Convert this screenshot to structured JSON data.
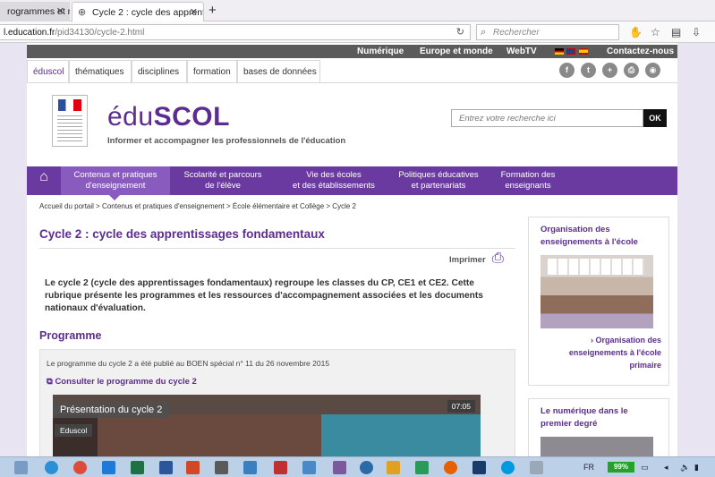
{
  "browser": {
    "tabs": [
      {
        "label": "rogrammes et r...",
        "active": false
      },
      {
        "label": "Cycle 2 : cycle des apprenti...",
        "active": true
      }
    ],
    "new_tab_symbol": "+",
    "close_symbol": "✕",
    "url_host": "l.education.fr",
    "url_path": "/pid34130/cycle-2.html",
    "search_placeholder": "Rechercher",
    "icons": [
      "reload-icon",
      "search-icon",
      "addon-icon",
      "bookmark-star-icon",
      "reading-list-icon",
      "download-icon"
    ]
  },
  "site": {
    "top_links": [
      "Numérique",
      "Europe et monde",
      "WebTV",
      "Contactez-nous"
    ],
    "menu_tabs": [
      "éduscol",
      "thématiques",
      "disciplines",
      "formation",
      "bases de données"
    ],
    "social_icons": [
      "facebook-icon",
      "twitter-icon",
      "google-plus-icon",
      "print-icon",
      "rss-icon"
    ],
    "logo": {
      "word_light": "édu",
      "word_bold": "SCOL",
      "tagline": "Informer et accompagner les professionnels de l'éducation"
    },
    "search": {
      "placeholder": "Entrez votre recherche ici",
      "button": "OK"
    },
    "main_nav": [
      {
        "label": "Contenus et pratiques\nd'enseignement",
        "current": true
      },
      {
        "label": "Scolarité et parcours\nde l'élève",
        "current": false
      },
      {
        "label": "Vie des écoles\net des établissements",
        "current": false
      },
      {
        "label": "Politiques éducatives\net partenariats",
        "current": false
      },
      {
        "label": "Formation des\nenseignants",
        "current": false
      }
    ],
    "breadcrumb": "Accueil du portail > Contenus et pratiques d'enseignement > École élémentaire et Collège > Cycle 2",
    "page_title": "Cycle 2 : cycle des apprentissages fondamentaux",
    "print_label": "Imprimer",
    "intro": "Le cycle 2 (cycle des apprentissages fondamentaux) regroupe les classes du CP, CE1 et CE2. Cette rubrique présente les programmes et les ressources d'accompagnement associées et les documents nationaux d'évaluation.",
    "section_heading": "Programme",
    "programme_note": "Le programme du cycle 2 a été publié au BOEN spécial n° 11 du 26 novembre 2015",
    "programme_link": "Consulter le programme du cycle 2",
    "video": {
      "title": "Présentation du cycle 2",
      "duration": "07:05",
      "source": "Eduscol"
    },
    "sidebar": [
      {
        "title": "Organisation des enseignements à l'école",
        "link": "Organisation des enseignements à l'école primaire"
      },
      {
        "title": "Le numérique dans le premier degré"
      }
    ]
  },
  "taskbar": {
    "language": "FR",
    "battery": "99%"
  },
  "colors": {
    "brand_purple": "#5c2d91",
    "nav_purple": "#6b3aa0",
    "nav_current": "#8a5bbf",
    "taskbar": "#bcd1e8",
    "battery": "#26a22a"
  }
}
